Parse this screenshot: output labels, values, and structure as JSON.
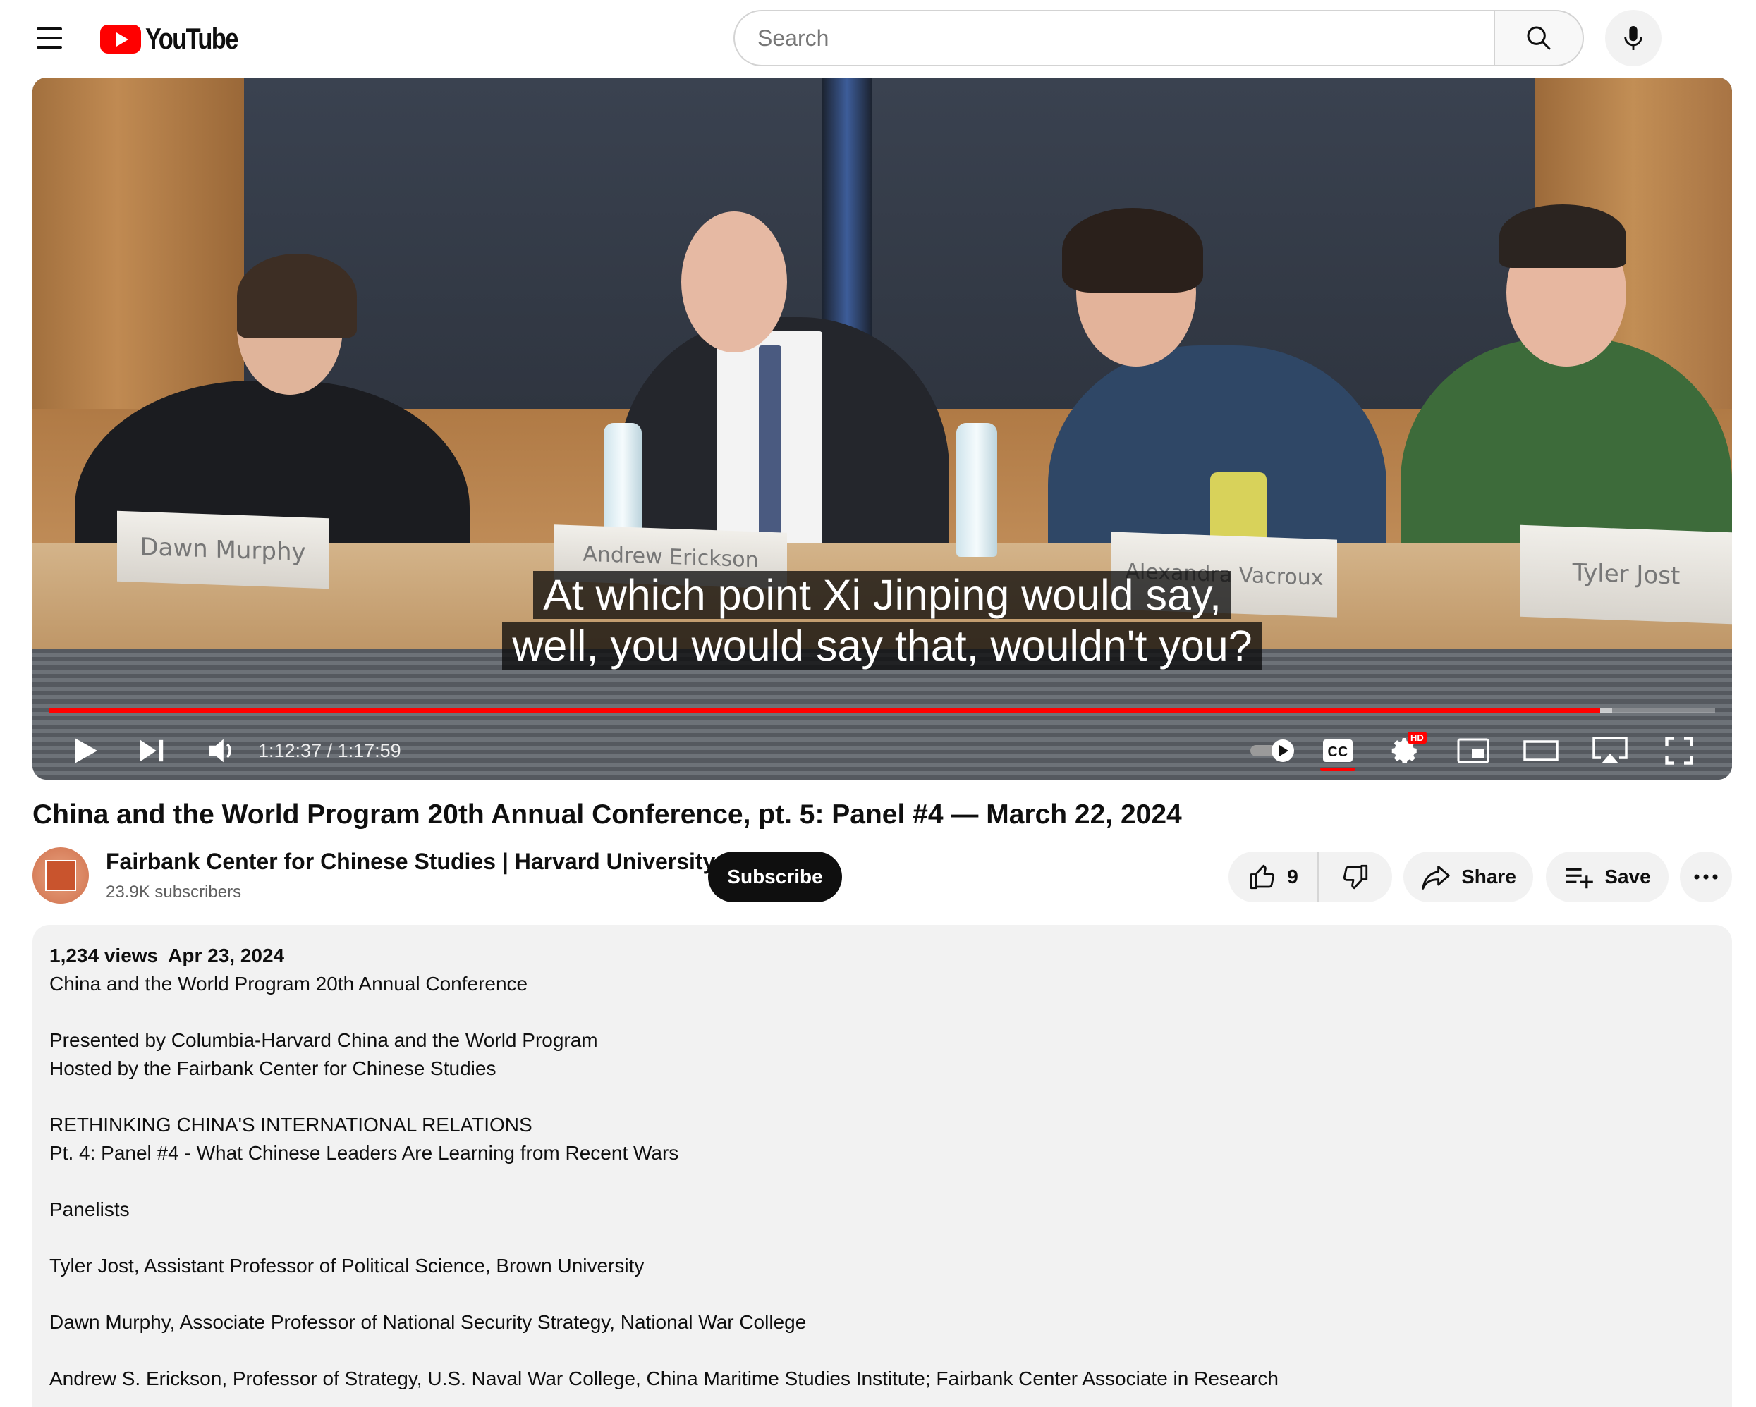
{
  "header": {
    "logo_text": "YouTube",
    "search_placeholder": "Search"
  },
  "player": {
    "caption_line1": "At which point Xi Jinping would say,",
    "caption_line2": "well, you would say that, wouldn't you?",
    "nameplates": [
      "Dawn Murphy",
      "Andrew Erickson",
      "Alexandra Vacroux",
      "Tyler Jost"
    ],
    "current_time": "1:12:37",
    "duration": "1:17:59",
    "time_display": "1:12:37 / 1:17:59",
    "progress_fraction": 0.931,
    "buffered_fraction": 0.938,
    "hd_badge": "HD",
    "cc_label": "CC",
    "accent_color": "#ff0000"
  },
  "video": {
    "title": "China and the World Program 20th Annual Conference, pt. 5: Panel #4 — March 22, 2024"
  },
  "channel": {
    "name": "Fairbank Center for Chinese Studies | Harvard University",
    "subscribers": "23.9K subscribers",
    "subscribe_label": "Subscribe"
  },
  "actions": {
    "like_count": "9",
    "share_label": "Share",
    "save_label": "Save"
  },
  "description": {
    "views": "1,234 views",
    "date": "Apr 23, 2024",
    "lines": [
      "China and the World Program 20th Annual Conference",
      "",
      "Presented by Columbia-Harvard China and the World Program",
      "Hosted by the Fairbank Center for Chinese Studies",
      "",
      "RETHINKING CHINA'S INTERNATIONAL RELATIONS",
      "Pt. 4: Panel #4 - What Chinese Leaders Are Learning from Recent Wars",
      "",
      "Panelists",
      "",
      "Tyler Jost, Assistant Professor of Political Science, Brown University",
      "",
      "Dawn Murphy, Associate Professor of National Security Strategy, National War College",
      "",
      "Andrew S. Erickson, Professor of Strategy, U.S. Naval War College, China Maritime Studies Institute; Fairbank Center Associate in Research"
    ]
  }
}
